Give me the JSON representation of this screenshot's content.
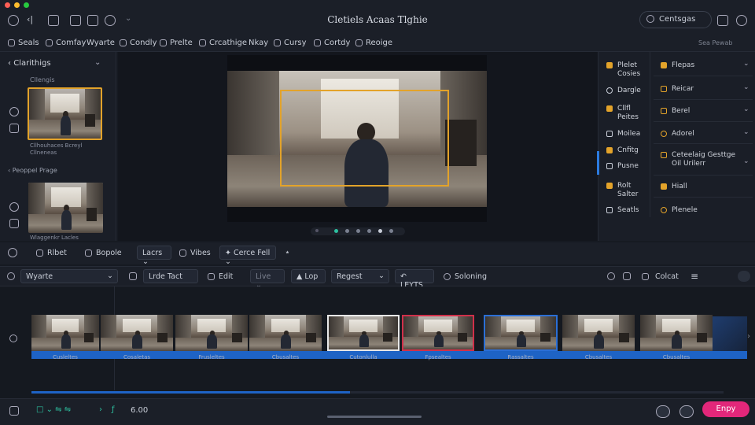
{
  "window": {
    "title": "Cletiels Acaas Tlghie"
  },
  "header": {
    "account_label": "Centsgas",
    "colors": {
      "close": "#ff5f56",
      "minimize": "#ffbd2e",
      "maximize": "#27c93f",
      "accent": "#e3a32a",
      "export": "#e2277a",
      "track": "#1e63c5"
    }
  },
  "menu": {
    "items": [
      "Seals",
      "Comfay",
      "Wyarte",
      "Condly",
      "Prelte",
      "Crcathige",
      "Nkay",
      "Cursy",
      "Cortdy",
      "Reoige"
    ],
    "right_label": "Sea Pewab"
  },
  "left_panel": {
    "section1_title": "Clarithigs",
    "section1_sub": "Cllengis",
    "caption1": "Cllhouhaces Bcreyl\nCllneneas",
    "section2_title": "Peoppel Prage",
    "caption2": "Wlaggenkr Lacles"
  },
  "right_panel": {
    "col1": [
      {
        "label": "Plelet\nCosies",
        "icon": "folder-icon",
        "color": "#e3a32a"
      },
      {
        "label": "Dargle",
        "icon": "cloud-icon",
        "color": "#c9ced8"
      },
      {
        "label": "Cllfl\nPeites",
        "icon": "wand-icon",
        "color": "#e3a32a"
      },
      {
        "label": "Moilea",
        "icon": "grid-icon",
        "color": "#c9ced8"
      },
      {
        "label": "Cnfitg",
        "icon": "tag-icon",
        "color": "#e3a32a"
      },
      {
        "label": "Pusne",
        "icon": "brush-icon",
        "color": "#c9ced8"
      },
      {
        "label": "Rolt\nSalter",
        "icon": "effects-icon",
        "color": "#e3a32a"
      },
      {
        "label": "Seatls",
        "icon": "sliders-icon",
        "color": "#c9ced8"
      }
    ],
    "col2": [
      {
        "label": "Flepas",
        "icon": "file-icon",
        "color": "#e3a32a"
      },
      {
        "label": "Reicar",
        "icon": "box-icon",
        "color": "#e3a32a"
      },
      {
        "label": "Berel",
        "icon": "frame-icon",
        "color": "#e3a32a"
      },
      {
        "label": "Adorel",
        "icon": "circle-icon",
        "color": "#e3a32a"
      },
      {
        "label": "Ceteelaig Gesttge\nOil Urilerr",
        "icon": "grid-icon",
        "color": "#e3a32a"
      },
      {
        "label": "Hiall",
        "icon": "hand-icon",
        "color": "#e3a32a"
      },
      {
        "label": "Plenele",
        "icon": "globe-icon",
        "color": "#e3a32a"
      }
    ]
  },
  "toolbar1": {
    "items": [
      "Rlbet",
      "Bopole",
      "Lacrs",
      "Vibes",
      "Cerce Fell"
    ]
  },
  "toolbar2": {
    "search_value": "Wyarte",
    "items": [
      "Lrde Tact",
      "Edit",
      "Live",
      "Lop",
      "Regest",
      "LEYTS",
      "Soloning",
      "Colcat"
    ]
  },
  "timeline": {
    "clips": [
      "Cusleltes",
      "Cosaletas",
      "Frusleltes",
      "Cbusaltes",
      "Cutonlulla",
      "Fpsealtes",
      "Rassaltes",
      "Cbusaltes",
      "Cbusaltes"
    ],
    "selected_index": 5,
    "playhead_percent": 46
  },
  "bottom": {
    "zoom": "6.00",
    "export_label": "Enpy"
  }
}
